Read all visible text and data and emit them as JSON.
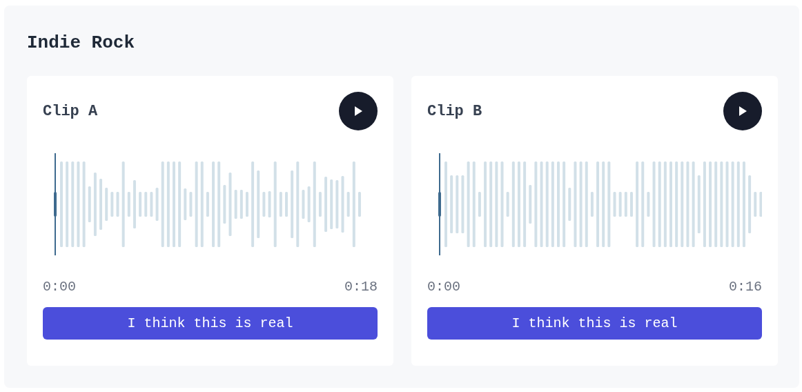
{
  "section": {
    "title": "Indie Rock"
  },
  "clips": [
    {
      "title": "Clip A",
      "start_time": "0:00",
      "end_time": "0:18",
      "vote_button": "I think this is real"
    },
    {
      "title": "Clip B",
      "start_time": "0:00",
      "end_time": "0:16",
      "vote_button": "I think this is real"
    }
  ]
}
